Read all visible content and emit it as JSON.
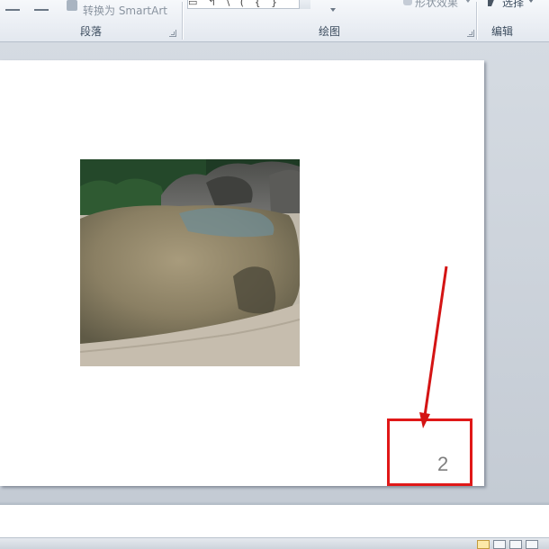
{
  "ribbon": {
    "groups": {
      "paragraph": {
        "label": "段落"
      },
      "drawing": {
        "label": "绘图"
      },
      "editing": {
        "label": "编辑"
      }
    },
    "convert_smartart_label": "转换为 SmartArt",
    "shape_effects_label": "形状效果",
    "select_label": "选择",
    "shape_gallery_glyphs": "▭ ↰ \\ ( { }"
  },
  "slide": {
    "page_number": "2"
  },
  "colors": {
    "highlight": "#e01818",
    "arrow": "#d41414"
  }
}
